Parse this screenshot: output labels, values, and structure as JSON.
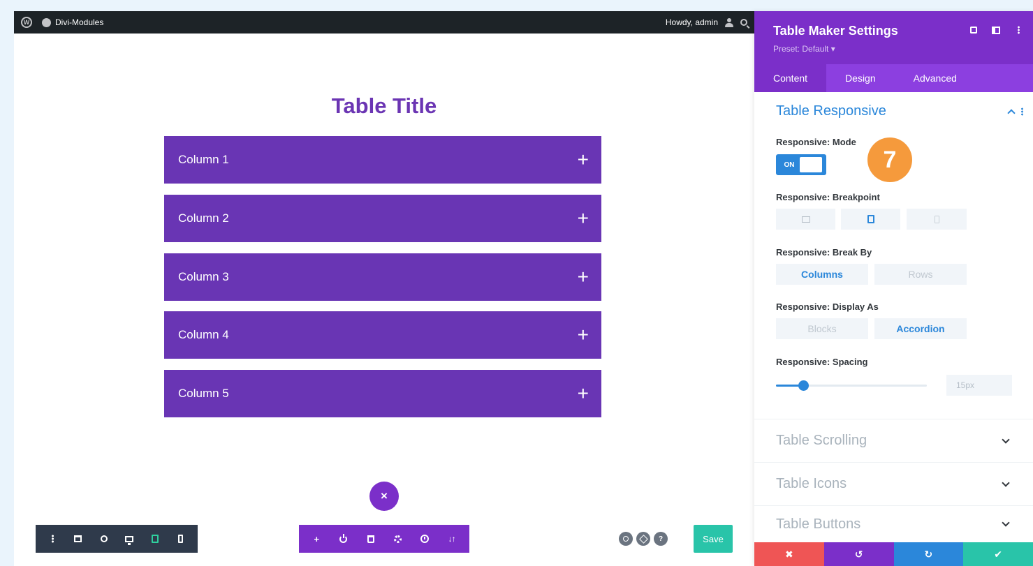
{
  "admin_bar": {
    "site_name": "Divi-Modules",
    "greeting": "Howdy, admin",
    "wp_logo": "W"
  },
  "builder": {
    "table_title": "Table Title",
    "columns": [
      {
        "label": "Column 1",
        "expand_icon": "+"
      },
      {
        "label": "Column 2",
        "expand_icon": "+"
      },
      {
        "label": "Column 3",
        "expand_icon": "+"
      },
      {
        "label": "Column 4",
        "expand_icon": "+"
      },
      {
        "label": "Column 5",
        "expand_icon": "+"
      }
    ],
    "close_icon": "×",
    "save_label": "Save",
    "help_icons": [
      "search-icon",
      "layers-icon",
      "help-icon"
    ],
    "help_glyph": "?",
    "page_toolbar_icons": [
      "menu-icon",
      "wireframe-icon",
      "zoom-icon",
      "desktop-icon",
      "tablet-icon",
      "phone-icon"
    ],
    "section_toolbar_icons": [
      "add-icon",
      "power-icon",
      "trash-icon",
      "settings-icon",
      "history-icon",
      "sort-icon"
    ],
    "add_glyph": "+",
    "sort_glyph": "↓↑"
  },
  "panel": {
    "title": "Table Maker Settings",
    "preset": "Preset: Default ▾",
    "tabs": [
      {
        "label": "Content",
        "active": true
      },
      {
        "label": "Design",
        "active": false
      },
      {
        "label": "Advanced",
        "active": false
      }
    ],
    "section_title": "Table Responsive",
    "fields": {
      "mode_label": "Responsive: Mode",
      "mode_toggle": "ON",
      "breakpoint_label": "Responsive: Breakpoint",
      "breakpoint_options": [
        "desktop-icon",
        "tablet-icon",
        "phone-icon"
      ],
      "breakpoint_selected": "tablet-icon",
      "break_by_label": "Responsive: Break By",
      "break_by_options": [
        "Columns",
        "Rows"
      ],
      "break_by_selected": "Columns",
      "display_as_label": "Responsive: Display As",
      "display_as_options": [
        "Blocks",
        "Accordion"
      ],
      "display_as_selected": "Accordion",
      "spacing_label": "Responsive: Spacing",
      "spacing_value": "15px",
      "spacing_fraction": 0.18
    },
    "collapsed_sections": [
      "Table Scrolling",
      "Table Icons",
      "Table Buttons"
    ],
    "footer_buttons": [
      {
        "name": "discard",
        "glyph": "✖",
        "color": "#ef5555"
      },
      {
        "name": "undo",
        "glyph": "↺",
        "color": "#7b2fc9"
      },
      {
        "name": "redo",
        "glyph": "↻",
        "color": "#2b87da"
      },
      {
        "name": "save",
        "glyph": "✔",
        "color": "#29c4a9"
      }
    ]
  },
  "step_badge": "7",
  "colors": {
    "purple": "#6935b4",
    "header_purple": "#7b2fc9",
    "accent_blue": "#2b87da",
    "save_green": "#29c4a9",
    "badge_orange": "#f59a3c"
  }
}
